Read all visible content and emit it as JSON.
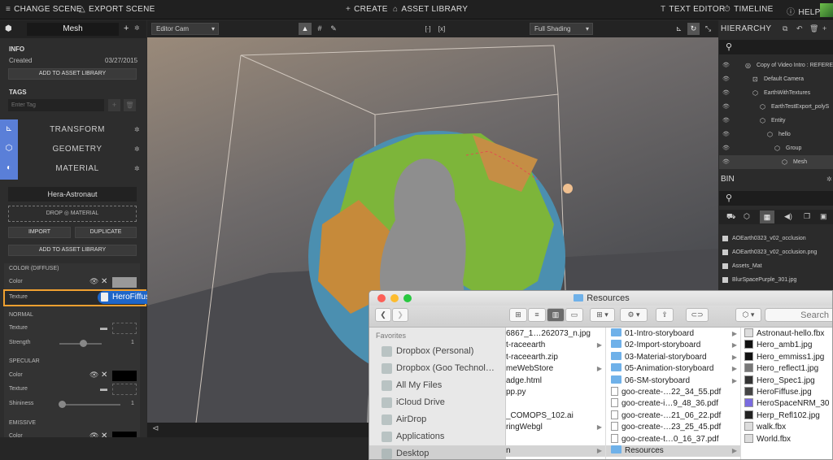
{
  "topbar": {
    "change_scene": "CHANGE SCENE",
    "export_scene": "EXPORT SCENE",
    "create": "CREATE",
    "asset_library": "ASSET LIBRARY",
    "text_editor": "TEXT EDITOR",
    "timeline": "TIMELINE",
    "help": "HELP"
  },
  "left_panel": {
    "title": "Mesh",
    "info_label": "INFO",
    "created_label": "Created",
    "created_date": "03/27/2015",
    "add_to_asset_library": "ADD TO ASSET LIBRARY",
    "tags_label": "TAGS",
    "tag_placeholder": "Enter Tag",
    "tabs": [
      "TRANSFORM",
      "GEOMETRY",
      "MATERIAL"
    ],
    "material_name": "Hera-Astronaut",
    "drop_material": "DROP ◎ MATERIAL",
    "import": "IMPORT",
    "duplicate": "DUPLICATE",
    "add_to_asset_library_2": "ADD TO ASSET LIBRARY",
    "color_diffuse_label": "COLOR (DIFFUSE)",
    "color_label": "Color",
    "texture_label": "Texture",
    "drag_file": "HeroFiffuse.jpg",
    "normal_label": "NORMAL",
    "normal_texture": "Texture",
    "strength_label": "Strength",
    "strength_value": "1",
    "specular_label": "SPECULAR",
    "specular_color": "Color",
    "specular_texture": "Texture",
    "shininess_label": "Shininess",
    "shininess_value": "1",
    "emissive_label": "EMISSIVE",
    "emissive_color": "Color"
  },
  "viewport": {
    "camera": "Editor Cam",
    "shading": "Full Shading"
  },
  "hierarchy": {
    "title": "HIERARCHY",
    "items": [
      {
        "label": "Copy of Video Intro : REFERE",
        "indent": 0
      },
      {
        "label": "Default Camera",
        "indent": 1
      },
      {
        "label": "EarthWithTextures",
        "indent": 1
      },
      {
        "label": "EarthTestExport_polyS",
        "indent": 2
      },
      {
        "label": "Entity",
        "indent": 2
      },
      {
        "label": "hello",
        "indent": 3
      },
      {
        "label": "Group",
        "indent": 4
      },
      {
        "label": "Mesh",
        "indent": 5
      }
    ]
  },
  "bin": {
    "title": "BIN",
    "items": [
      "AOEarth0323_v02_occlusion",
      "AOEarth0323_v02_occlusion.png",
      "Assets_Mat",
      "BlurSpacePurple_301.jpg"
    ]
  },
  "finder": {
    "title": "Resources",
    "search_placeholder": "Search",
    "favorites_label": "Favorites",
    "sidebar": [
      "Dropbox (Personal)",
      "Dropbox (Goo Technol…",
      "All My Files",
      "iCloud Drive",
      "AirDrop",
      "Applications",
      "Desktop"
    ],
    "col1": [
      "6867_1…262073_n.jpg",
      "t-raceearth",
      "t-raceearth.zip",
      "meWebStore",
      "adge.html",
      "pp.py",
      "",
      "_COMOPS_102.ai",
      "ringWebgl",
      "",
      "n"
    ],
    "col2": [
      "01-Intro-storyboard",
      "02-Import-storyboard",
      "03-Material-storyboard",
      "05-Animation-storyboard",
      "06-SM-storyboard",
      "goo-create-…22_34_55.pdf",
      "goo-create-i…9_48_36.pdf",
      "goo-create-…21_06_22.pdf",
      "goo-create-…23_25_45.pdf",
      "goo-create-t…0_16_37.pdf",
      "Resources"
    ],
    "col3": [
      "Astronaut-hello.fbx",
      "Hero_amb1.jpg",
      "Hero_emmiss1.jpg",
      "Hero_reflect1.jpg",
      "Hero_Spec1.jpg",
      "HeroFiffuse.jpg",
      "HeroSpaceNRM_30",
      "Herp_Refl102.jpg",
      "walk.fbx",
      "World.fbx"
    ]
  }
}
